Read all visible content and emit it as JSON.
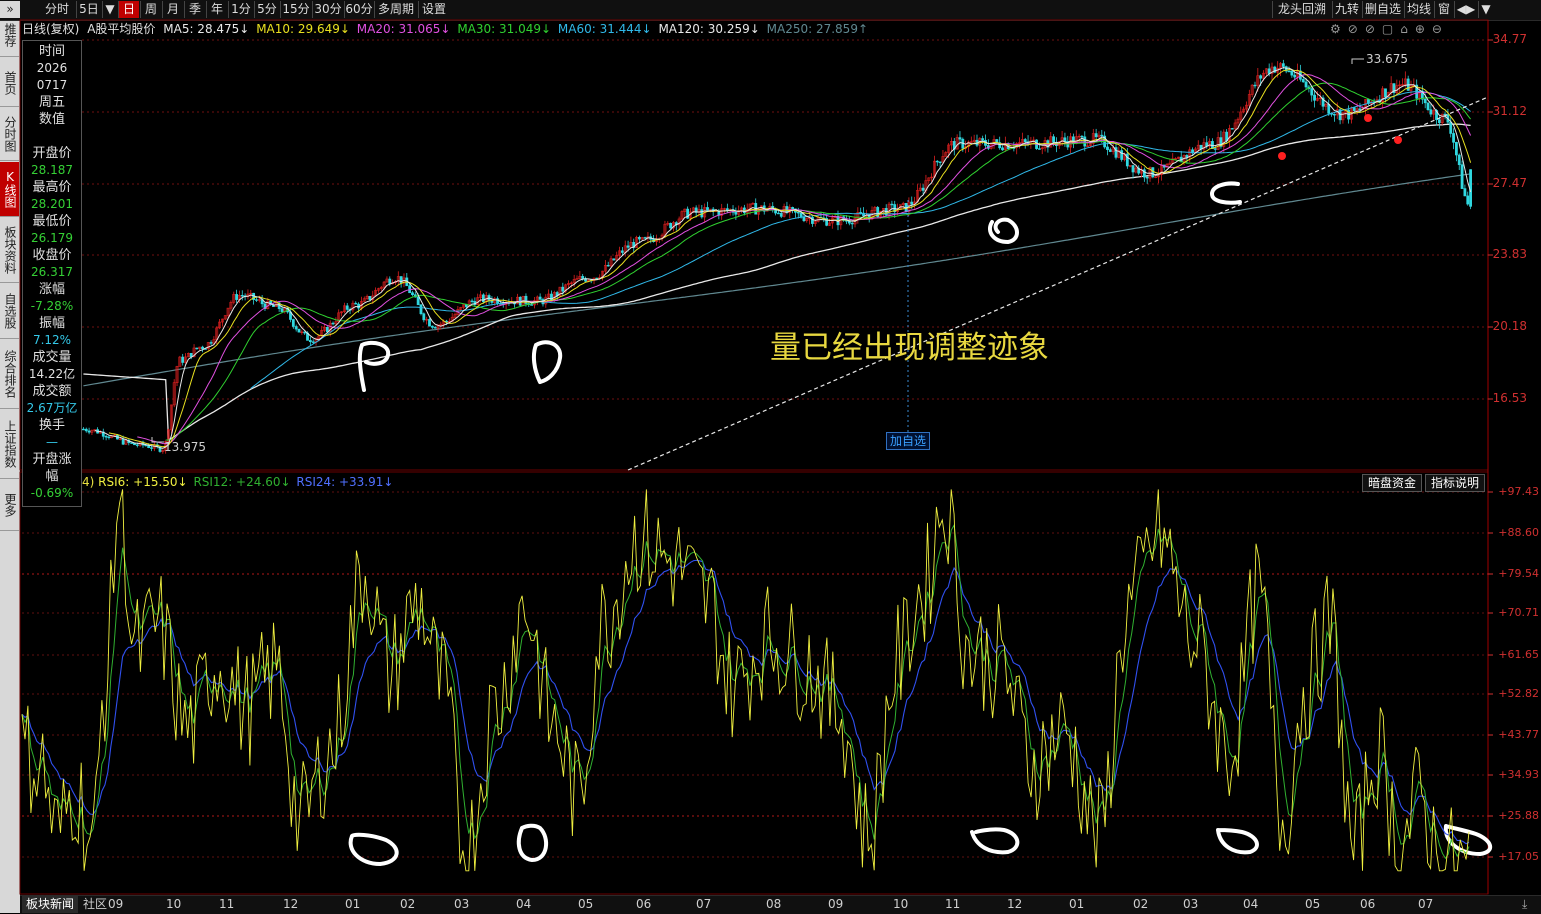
{
  "toolbar": {
    "periods": [
      {
        "label": "分时",
        "active": false
      },
      {
        "label": "5日",
        "active": false
      },
      {
        "label": "▼",
        "active": false
      },
      {
        "label": "日",
        "active": true
      },
      {
        "label": "周",
        "active": false
      },
      {
        "label": "月",
        "active": false
      },
      {
        "label": "季",
        "active": false
      },
      {
        "label": "年",
        "active": false
      },
      {
        "label": "1分",
        "active": false
      },
      {
        "label": "5分",
        "active": false
      },
      {
        "label": "15分",
        "active": false
      },
      {
        "label": "30分",
        "active": false
      },
      {
        "label": "60分",
        "active": false
      },
      {
        "label": "多周期",
        "active": false
      },
      {
        "label": "设置",
        "active": false
      }
    ],
    "right_buttons": [
      "龙头回溯",
      "九转",
      "删自选",
      "均线",
      "窗",
      "◀▶",
      "▼"
    ]
  },
  "left_tabs": [
    {
      "label": "»推荐",
      "active": false
    },
    {
      "label": "首页",
      "active": false
    },
    {
      "label": "分时图",
      "active": false
    },
    {
      "label": "K线图",
      "active": true
    },
    {
      "label": "板块资料",
      "active": false
    },
    {
      "label": "自选股",
      "active": false
    },
    {
      "label": "综合排名",
      "active": false
    },
    {
      "label": "上证指数",
      "active": false
    },
    {
      "label": "更多",
      "active": false
    }
  ],
  "legend": {
    "title": "日线(复权)",
    "name": "A股平均股价",
    "ma5": "MA5: 28.475↓",
    "ma10": "MA10: 29.649↓",
    "ma20": "MA20: 31.065↓",
    "ma30": "MA30: 31.049↓",
    "ma60": "MA60: 31.444↓",
    "ma120": "MA120: 30.259↓",
    "ma250": "MA250: 27.859↑"
  },
  "colors": {
    "ma5": "#e8e8e8",
    "ma10": "#e8e020",
    "ma20": "#e050e0",
    "ma30": "#30d030",
    "ma60": "#30b8e8",
    "ma120": "#e8e8e8",
    "ma250": "#608890",
    "up": "#e02020",
    "down": "#30d8e0",
    "grid": "#5a0000",
    "axis": "#d03030",
    "rsi6": "#f0f040",
    "rsi12": "#30b030",
    "rsi24": "#3050f0"
  },
  "info_panel": {
    "time_label": "时间",
    "year": "2026",
    "date": "0717",
    "weekday": "周五",
    "value_label": "数值",
    "open_label": "开盘价",
    "open": "28.187",
    "high_label": "最高价",
    "high": "28.201",
    "low_label": "最低价",
    "low": "26.179",
    "close_label": "收盘价",
    "close": "26.317",
    "change_label": "涨幅",
    "change": "-7.28%",
    "amp_label": "振幅",
    "amp": "7.12%",
    "vol_label": "成交量",
    "vol": "14.22亿",
    "amount_label": "成交额",
    "amount": "2.67万亿",
    "turnover_label": "换手",
    "turnover": "—",
    "open_change_label": "开盘涨幅",
    "open_change": "-0.69%"
  },
  "price_axis": [
    "34.77",
    "31.12",
    "27.47",
    "23.83",
    "20.18",
    "16.53"
  ],
  "annotations": {
    "high": "33.675",
    "low": "13.975",
    "add_watch": "加自选",
    "comment": "量已经出现调整迹象"
  },
  "rsi": {
    "prefix": "4)",
    "rsi6": "RSI6: +15.50↓",
    "rsi12": "RSI12: +24.60↓",
    "rsi24": "RSI24: +33.91↓",
    "axis": [
      "+97.43",
      "+88.60",
      "+79.54",
      "+70.71",
      "+61.65",
      "+52.82",
      "+43.77",
      "+34.93",
      "+25.88",
      "+17.05"
    ],
    "buttons": [
      "暗盘资金",
      "指标说明"
    ]
  },
  "bottom": {
    "tabs": [
      {
        "label": "板块新闻",
        "active": true
      },
      {
        "label": "社区",
        "active": false
      }
    ],
    "months": [
      "09",
      "10",
      "11",
      "12",
      "01",
      "02",
      "03",
      "04",
      "05",
      "06",
      "07",
      "08",
      "09",
      "10",
      "11",
      "12",
      "01",
      "02",
      "03",
      "04",
      "05",
      "06",
      "07"
    ]
  },
  "chart_data": {
    "type": "candlestick",
    "price_ylim": [
      13.0,
      36.0
    ],
    "rsi_ylim": [
      12.0,
      100.0
    ],
    "price_anchors": [
      [
        0,
        15.0
      ],
      [
        20,
        14.2
      ],
      [
        28,
        14.0
      ],
      [
        34,
        18.5
      ],
      [
        42,
        19.2
      ],
      [
        55,
        21.8
      ],
      [
        68,
        21.2
      ],
      [
        80,
        19.6
      ],
      [
        96,
        21.3
      ],
      [
        110,
        22.7
      ],
      [
        124,
        20.3
      ],
      [
        140,
        21.6
      ],
      [
        160,
        21.5
      ],
      [
        178,
        22.7
      ],
      [
        196,
        24.5
      ],
      [
        215,
        26.0
      ],
      [
        238,
        26.2
      ],
      [
        265,
        25.6
      ],
      [
        288,
        26.2
      ],
      [
        308,
        29.5
      ],
      [
        330,
        29.5
      ],
      [
        356,
        29.7
      ],
      [
        376,
        28.0
      ],
      [
        398,
        29.5
      ],
      [
        420,
        33.4
      ],
      [
        445,
        31.0
      ],
      [
        465,
        32.5
      ],
      [
        480,
        30.8
      ],
      [
        489,
        26.3
      ]
    ],
    "rsi_anchors": [
      [
        0,
        40
      ],
      [
        6,
        38
      ],
      [
        12,
        22
      ],
      [
        18,
        32
      ],
      [
        24,
        20
      ],
      [
        28,
        55
      ],
      [
        33,
        97
      ],
      [
        38,
        62
      ],
      [
        46,
        68
      ],
      [
        56,
        45
      ],
      [
        66,
        60
      ],
      [
        76,
        50
      ],
      [
        86,
        58
      ],
      [
        94,
        25
      ],
      [
        104,
        40
      ],
      [
        116,
        80
      ],
      [
        124,
        58
      ],
      [
        134,
        73
      ],
      [
        142,
        55
      ],
      [
        150,
        18
      ],
      [
        160,
        50
      ],
      [
        170,
        72
      ],
      [
        180,
        45
      ],
      [
        188,
        30
      ],
      [
        196,
        68
      ],
      [
        208,
        87
      ],
      [
        220,
        82
      ],
      [
        232,
        73
      ],
      [
        240,
        55
      ],
      [
        252,
        65
      ],
      [
        264,
        60
      ],
      [
        276,
        50
      ],
      [
        286,
        22
      ],
      [
        296,
        60
      ],
      [
        304,
        75
      ],
      [
        312,
        95
      ],
      [
        320,
        62
      ],
      [
        330,
        60
      ],
      [
        342,
        38
      ],
      [
        352,
        45
      ],
      [
        364,
        22
      ],
      [
        374,
        72
      ],
      [
        384,
        88
      ],
      [
        396,
        65
      ],
      [
        408,
        40
      ],
      [
        418,
        75
      ],
      [
        426,
        25
      ],
      [
        434,
        55
      ],
      [
        442,
        68
      ],
      [
        450,
        18
      ],
      [
        458,
        40
      ],
      [
        466,
        20
      ],
      [
        472,
        30
      ],
      [
        480,
        16
      ],
      [
        489,
        15
      ]
    ],
    "candles": 490
  }
}
